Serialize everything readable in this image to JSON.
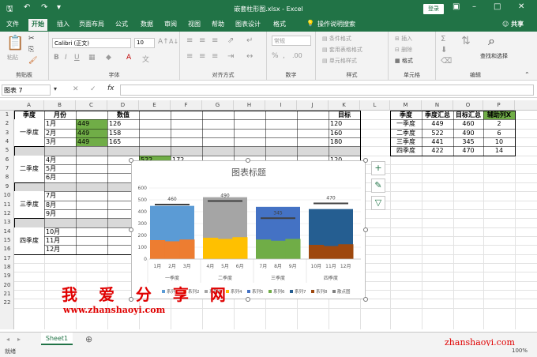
{
  "window": {
    "title": "嵌套柱形图.xlsx  -  Excel",
    "login": "登录",
    "share": "共享"
  },
  "ribbon_tabs": [
    "文件",
    "开始",
    "插入",
    "页面布局",
    "公式",
    "数据",
    "审阅",
    "视图",
    "帮助",
    "图表设计",
    "格式"
  ],
  "tell_me": "操作说明搜索",
  "ribbon": {
    "clipboard": {
      "label": "剪贴板",
      "paste": "粘贴"
    },
    "font": {
      "label": "字体",
      "name": "Calibri (正文)",
      "size": "10"
    },
    "align": {
      "label": "对齐方式"
    },
    "number": {
      "label": "数字",
      "format": "常规"
    },
    "styles": {
      "label": "样式",
      "cond": "条件格式",
      "table": "套用表格格式",
      "cell": "单元格样式"
    },
    "cells": {
      "label": "单元格",
      "insert": "插入",
      "delete": "删除",
      "format": "格式"
    },
    "edit": {
      "label": "编辑",
      "find": "查找和选择"
    }
  },
  "formula_bar": {
    "name_box": "图表 7",
    "fx": "fx"
  },
  "columns": [
    "A",
    "B",
    "C",
    "D",
    "E",
    "F",
    "G",
    "H",
    "I",
    "J",
    "K",
    "L",
    "M",
    "N",
    "O",
    "P"
  ],
  "rows": [
    "1",
    "2",
    "3",
    "4",
    "5",
    "6",
    "7",
    "8",
    "9",
    "10",
    "11",
    "12",
    "13",
    "14",
    "15",
    "16",
    "17",
    "18",
    "19",
    "20",
    "21",
    "22"
  ],
  "table_left": {
    "headers": {
      "season": "季度",
      "month": "月份",
      "value": "数值",
      "target": "目标"
    },
    "seasons": [
      "一季度",
      "二季度",
      "三季度",
      "四季度"
    ],
    "months": [
      "1月",
      "2月",
      "3月",
      "4月",
      "5月",
      "6月",
      "7月",
      "8月",
      "9月",
      "10月",
      "11月",
      "12月"
    ],
    "c_values": [
      "449",
      "449",
      "449"
    ],
    "d_values": [
      "126",
      "158",
      "165"
    ],
    "targets": [
      "120",
      "160",
      "180"
    ],
    "row6_e": "522",
    "row6_f": "172",
    "row6_k": "120"
  },
  "table_right": {
    "headers": [
      "季度",
      "季度汇总",
      "目标汇总",
      "辅助列X"
    ],
    "rows": [
      [
        "一季度",
        "449",
        "460",
        "2"
      ],
      [
        "二季度",
        "522",
        "490",
        "6"
      ],
      [
        "三季度",
        "441",
        "345",
        "10"
      ],
      [
        "四季度",
        "422",
        "470",
        "14"
      ]
    ]
  },
  "chart": {
    "title": "图表标题",
    "ylim": [
      0,
      600
    ],
    "yticks": [
      "600",
      "500",
      "400",
      "300",
      "200",
      "100",
      "0"
    ],
    "groups": [
      "一季度",
      "二季度",
      "三季度",
      "四季度"
    ],
    "month_labels": [
      [
        "1月",
        "2月",
        "3月"
      ],
      [
        "4月",
        "5月",
        "6月"
      ],
      [
        "7月",
        "8月",
        "9月"
      ],
      [
        "10月",
        "11月",
        "12月"
      ]
    ],
    "targets": [
      "460",
      "490",
      "345",
      "470"
    ],
    "legend": [
      "系列1",
      "系列2",
      "系列3",
      "系列4",
      "系列5",
      "系列6",
      "系列7",
      "系列8",
      "散点图"
    ]
  },
  "chart_data": {
    "type": "bar",
    "title": "图表标题",
    "categories": [
      "一季度",
      "二季度",
      "三季度",
      "四季度"
    ],
    "ylim": [
      0,
      600
    ],
    "series": [
      {
        "name": "季度汇总",
        "values": [
          449,
          522,
          441,
          422
        ]
      },
      {
        "name": "目标汇总",
        "values": [
          460,
          490,
          345,
          470
        ]
      }
    ],
    "inner_fill_levels": [
      160,
      180,
      165,
      120
    ],
    "colors": {
      "q1": [
        "#ed7d31",
        "#5b9bd5"
      ],
      "q2": [
        "#ffc000",
        "#a5a5a5"
      ],
      "q3": [
        "#70ad47",
        "#4472c4"
      ],
      "q4": [
        "#9e480e",
        "#255e91"
      ]
    }
  },
  "sheet_tab": "Sheet1",
  "status": {
    "ready": "就绪",
    "zoom": "100%"
  },
  "watermark": {
    "cn": "我 爱 分 享 网",
    "url": "www.zhanshaoyi.com",
    "url2": "zhanshaoyi.com"
  }
}
